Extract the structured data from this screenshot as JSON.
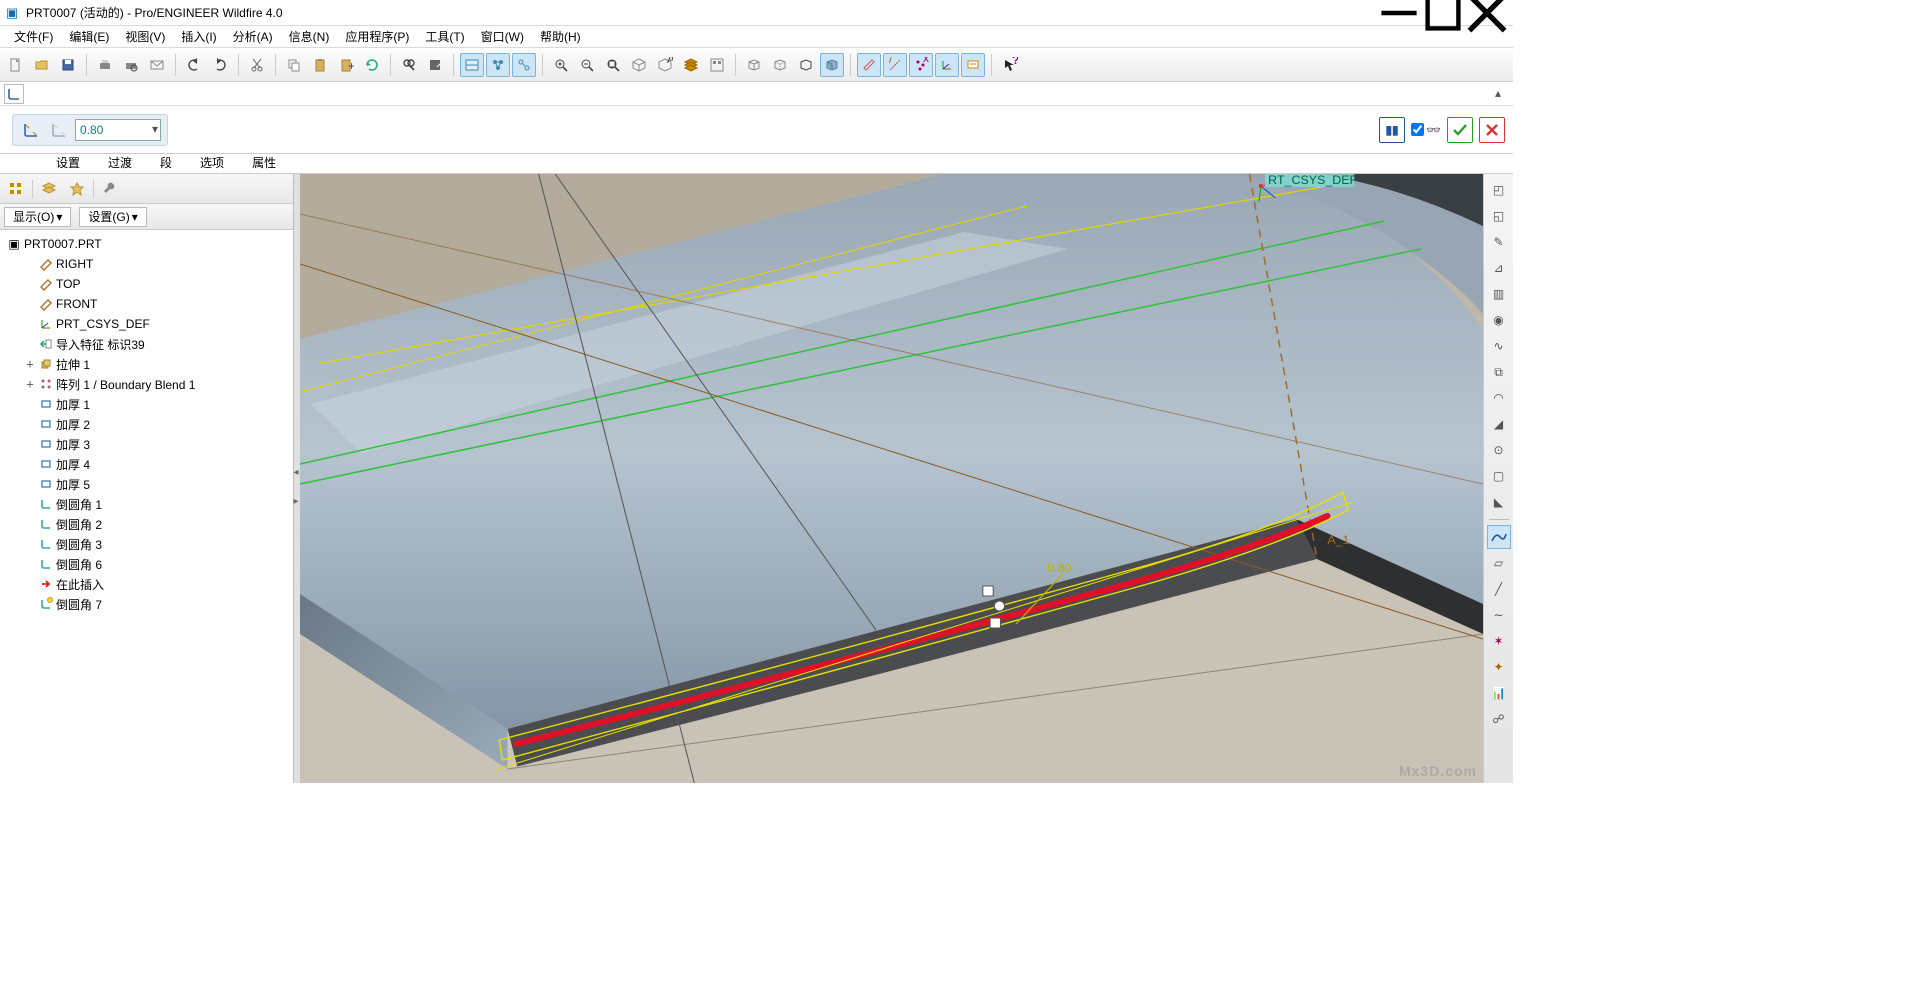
{
  "title": "PRT0007 (活动的) - Pro/ENGINEER Wildfire 4.0",
  "menus": [
    "文件(F)",
    "编辑(E)",
    "视图(V)",
    "插入(I)",
    "分析(A)",
    "信息(N)",
    "应用程序(P)",
    "工具(T)",
    "窗口(W)",
    "帮助(H)"
  ],
  "feature": {
    "value": "0.80",
    "tabs": [
      "设置",
      "过渡",
      "段",
      "选项",
      "属性"
    ]
  },
  "treeFilter": {
    "show": "显示(O)",
    "settings": "设置(G)"
  },
  "tree": {
    "root": "PRT0007.PRT",
    "items": [
      {
        "icon": "plane",
        "label": "RIGHT"
      },
      {
        "icon": "plane",
        "label": "TOP"
      },
      {
        "icon": "plane",
        "label": "FRONT"
      },
      {
        "icon": "csys",
        "label": "PRT_CSYS_DEF"
      },
      {
        "icon": "import",
        "label": "导入特征 标识39"
      },
      {
        "icon": "extrude",
        "label": "拉伸 1",
        "expander": "+"
      },
      {
        "icon": "pattern",
        "label": "阵列 1 / Boundary Blend 1",
        "expander": "+"
      },
      {
        "icon": "thicken",
        "label": "加厚 1"
      },
      {
        "icon": "thicken",
        "label": "加厚 2"
      },
      {
        "icon": "thicken",
        "label": "加厚 3"
      },
      {
        "icon": "thicken",
        "label": "加厚 4"
      },
      {
        "icon": "thicken",
        "label": "加厚 5"
      },
      {
        "icon": "round",
        "label": "倒圆角 1"
      },
      {
        "icon": "round",
        "label": "倒圆角 2"
      },
      {
        "icon": "round",
        "label": "倒圆角 3"
      },
      {
        "icon": "round",
        "label": "倒圆角 6"
      },
      {
        "icon": "insert",
        "label": "在此插入"
      },
      {
        "icon": "round-active",
        "label": "倒圆角 7"
      }
    ]
  },
  "viewport": {
    "dim_label": "0.80",
    "csys_label": "RT_CSYS_DEF"
  },
  "watermark": "Mx3D.com"
}
